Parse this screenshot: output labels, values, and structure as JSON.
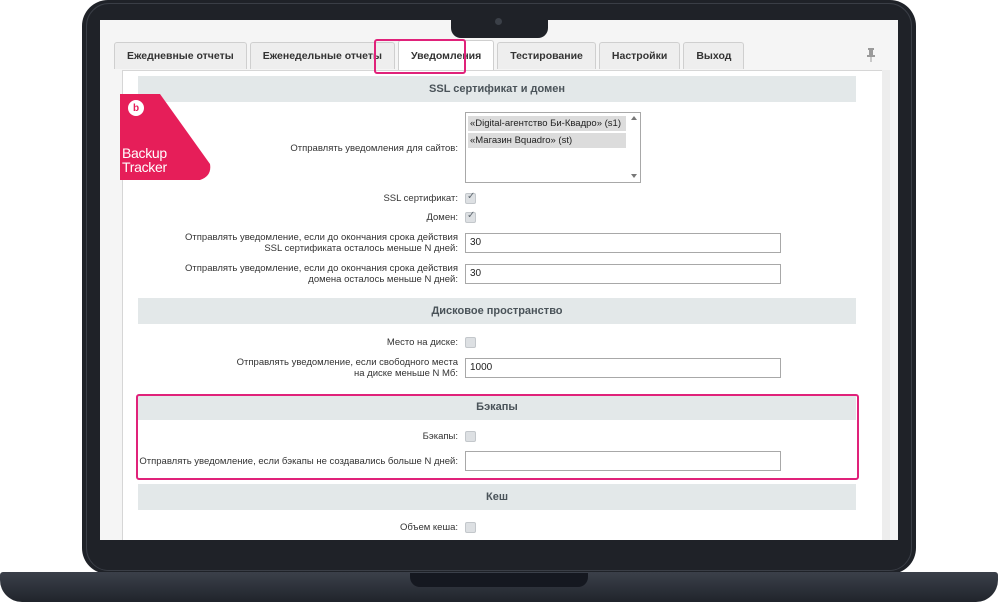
{
  "tabs": [
    {
      "label": "Ежедневные отчеты",
      "active": false
    },
    {
      "label": "Еженедельные отчеты",
      "active": false
    },
    {
      "label": "Уведомления",
      "active": true
    },
    {
      "label": "Тестирование",
      "active": false
    },
    {
      "label": "Настройки",
      "active": false
    },
    {
      "label": "Выход",
      "active": false
    }
  ],
  "logo": {
    "letter": "b",
    "line1": "Backup",
    "line2": "Tracker",
    "color": "#e61e59"
  },
  "ssl": {
    "title": "SSL сертификат и домен",
    "sites_label": "Отправлять уведомления для сайтов:",
    "sites": [
      "«Digital-агентство Би-Квадро» (s1)",
      "«Магазин Bquadro» (st)"
    ],
    "ssl_cert_label": "SSL сертификат:",
    "ssl_cert_checked": true,
    "domain_label": "Домен:",
    "domain_checked": true,
    "ssl_days_label_1": "Отправлять уведомление, если до окончания срока действия",
    "ssl_days_label_2": "SSL сертификата осталось меньше N дней:",
    "ssl_days_value": "30",
    "domain_days_label_1": "Отправлять уведомление, если до окончания срока действия",
    "domain_days_label_2": "домена осталось меньше N дней:",
    "domain_days_value": "30"
  },
  "disk": {
    "title": "Дисковое пространство",
    "space_label": "Место на диске:",
    "space_checked": false,
    "free_label_1": "Отправлять уведомление, если свободного места",
    "free_label_2": "на диске меньше N Мб:",
    "free_value": "1000"
  },
  "backups": {
    "title": "Бэкапы",
    "backups_label": "Бэкапы:",
    "backups_checked": false,
    "days_label": "Отправлять уведомление, если бэкапы не создавались больше N дней:",
    "days_value": ""
  },
  "cache": {
    "title": "Кеш",
    "size_label": "Объем кеша:",
    "size_checked": false
  },
  "colors": {
    "highlight": "#e0227a",
    "section_bg": "#e3e8e9"
  }
}
